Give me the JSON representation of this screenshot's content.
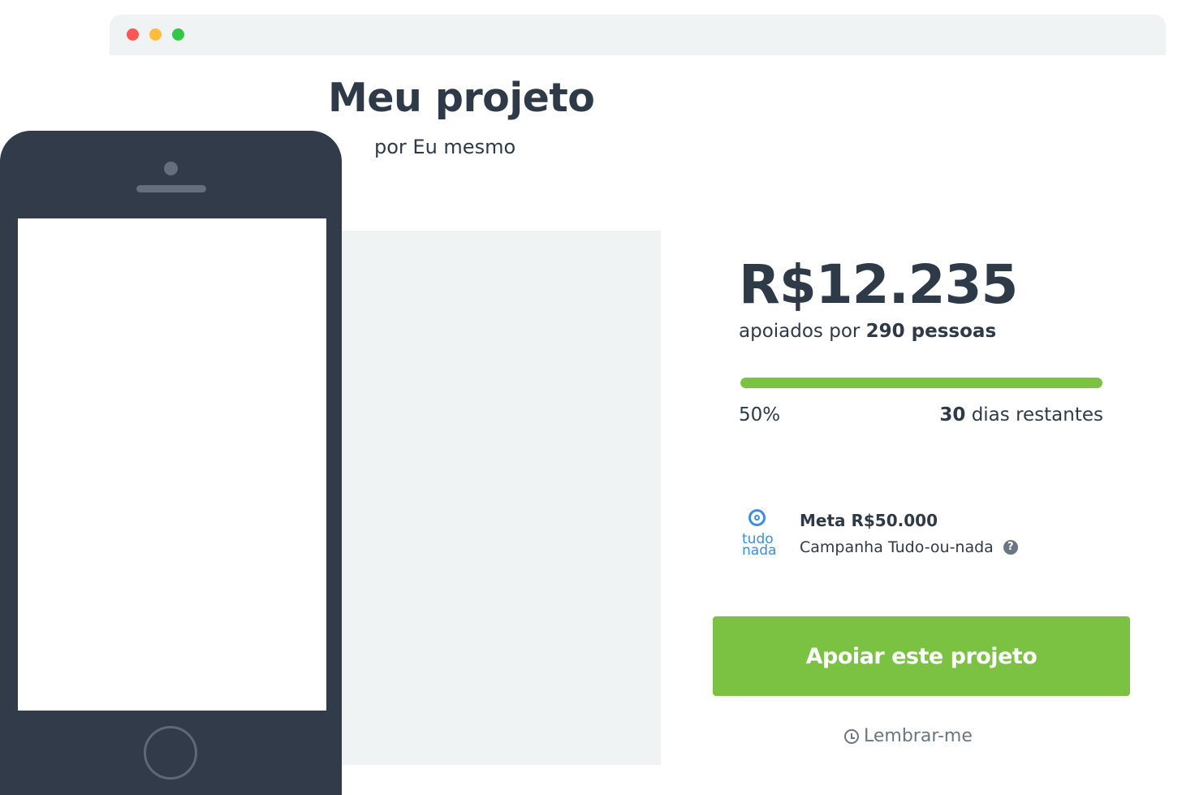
{
  "browser": {
    "window_controls": [
      "close",
      "minimize",
      "maximize"
    ]
  },
  "project": {
    "title": "Meu projeto",
    "byline": "por Eu mesmo"
  },
  "funding": {
    "amount": "R$12.235",
    "backers_prefix": "apoiados por",
    "backers_count": "290 pessoas",
    "progress_fraction": 1.0,
    "percent_label": "50%",
    "days_count": "30",
    "days_suffix": "dias restantes"
  },
  "campaign": {
    "logo_icon": "target-icon",
    "logo_top": "tudo",
    "logo_bottom": "nada",
    "goal": "Meta R$50.000",
    "type": "Campanha Tudo-ou-nada",
    "help_icon": "question-icon",
    "help_glyph": "?"
  },
  "actions": {
    "back_label": "Apoiar este projeto",
    "remind_label": "Lembrar-me",
    "remind_icon": "clock-icon"
  },
  "colors": {
    "accent_green": "#7bc142",
    "text_dark": "#2f3a48",
    "link_blue": "#3a8ee6",
    "phone_body": "#323b49"
  }
}
